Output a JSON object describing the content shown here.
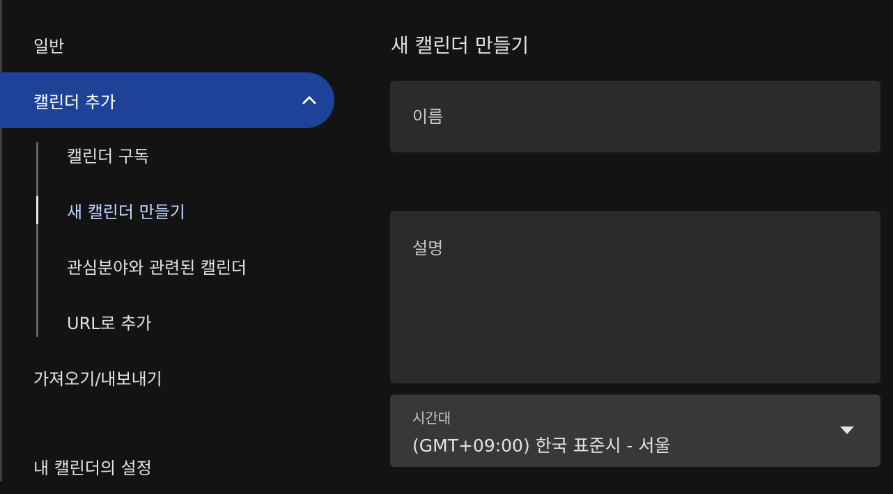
{
  "sidebar": {
    "general": "일반",
    "add_calendar": "캘린더 추가",
    "sub_items": [
      {
        "label": "캘린더 구독"
      },
      {
        "label": "새 캘린더 만들기"
      },
      {
        "label": "관심분야와 관련된 캘린더"
      },
      {
        "label": "URL로 추가"
      }
    ],
    "import_export": "가져오기/내보내기",
    "my_calendar_settings": "내 캘린더의 설정"
  },
  "main": {
    "title": "새 캘린더 만들기",
    "name_placeholder": "이름",
    "description_placeholder": "설명",
    "timezone": {
      "label": "시간대",
      "value": "(GMT+09:00) 한국 표준시 - 서울"
    }
  },
  "colors": {
    "background": "#131314",
    "active_nav": "#1e4297",
    "field_bg": "#2a2b2d",
    "select_bg": "#37383a"
  }
}
